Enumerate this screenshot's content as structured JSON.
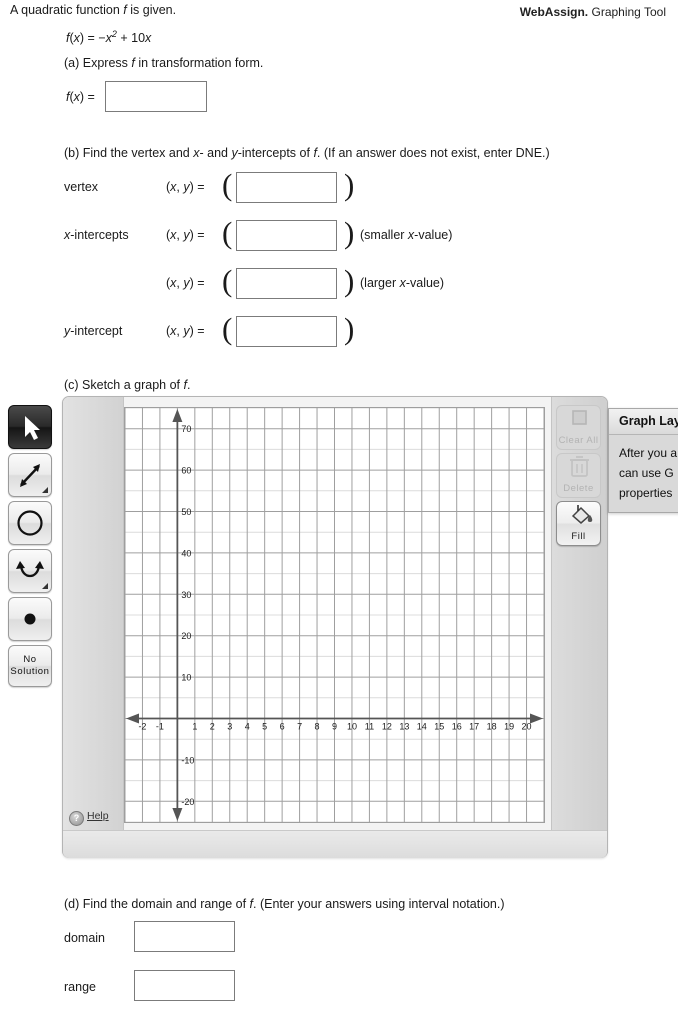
{
  "problem": {
    "intro_pre": "A quadratic function ",
    "intro_var": "f",
    "intro_post": " is given.",
    "equation": {
      "lhs_f": "f",
      "lhs_open": "(",
      "lhs_x": "x",
      "lhs_close": ")",
      "eq": " = −",
      "base": "x",
      "exponent": "2",
      "tail": " + 10",
      "tail_var": "x"
    }
  },
  "parts": {
    "a": {
      "label_pre": "(a) Express ",
      "label_var": "f",
      "label_post": " in transformation form.",
      "field_label_f": "f",
      "field_label_open": "(",
      "field_label_x": "x",
      "field_label_close": ") =",
      "input_value": "",
      "input_placeholder": ""
    },
    "b": {
      "label_pre": "(b) Find the vertex and ",
      "label_x": "x",
      "label_mid": "- and ",
      "label_y": "y",
      "label_post": "-intercepts of ",
      "label_f": "f",
      "label_end": ". (If an answer does not exist, enter DNE.)",
      "xy_label_open": "(",
      "xy_label_x": "x",
      "xy_label_comma": ", ",
      "xy_label_y": "y",
      "xy_label_close": ") =",
      "paren_open": "(",
      "paren_close": ")",
      "rows": [
        {
          "name_prefix": "",
          "name_italic": "",
          "name_suffix": "vertex",
          "value": "",
          "note": ""
        },
        {
          "name_prefix": "",
          "name_italic": "x",
          "name_suffix": "-intercepts",
          "value": "",
          "note_pre": "(smaller ",
          "note_var": "x",
          "note_post": "-value)"
        },
        {
          "name_prefix": "",
          "name_italic": "",
          "name_suffix": "",
          "value": "",
          "note_pre": "(larger ",
          "note_var": "x",
          "note_post": "-value)"
        },
        {
          "name_prefix": "",
          "name_italic": "y",
          "name_suffix": "-intercept",
          "value": "",
          "note": ""
        }
      ]
    },
    "c": {
      "label_pre": "(c) Sketch a graph of ",
      "label_var": "f",
      "label_post": "."
    },
    "d": {
      "label_pre": "(d) Find the domain and range of ",
      "label_var": "f",
      "label_post": ". (Enter your answers using interval notation.)",
      "domain_label": "domain",
      "domain_value": "",
      "range_label": "range",
      "range_value": ""
    }
  },
  "graph_tool": {
    "left_tools": [
      {
        "name": "pointer-tool",
        "icon": "cursor-arrow-icon",
        "label": "",
        "state": "selected"
      },
      {
        "name": "line-tool",
        "icon": "double-arrow-line-icon",
        "label": "",
        "state": "normal"
      },
      {
        "name": "circle-tool",
        "icon": "circle-icon",
        "label": "",
        "state": "normal"
      },
      {
        "name": "parabola-tool",
        "icon": "parabola-icon",
        "label": "",
        "state": "normal"
      },
      {
        "name": "point-tool",
        "icon": "filled-dot-icon",
        "label": "",
        "state": "normal"
      },
      {
        "name": "no-solution-tool",
        "icon": "",
        "label": "No\nSolution",
        "state": "normal"
      }
    ],
    "no_solution_line1": "No",
    "no_solution_line2": "Solution",
    "right_tools": [
      {
        "name": "clear-all-button",
        "icon": "square-outline-icon",
        "label": "Clear All",
        "state": "disabled"
      },
      {
        "name": "delete-button",
        "icon": "trash-can-icon",
        "label": "Delete",
        "state": "disabled"
      },
      {
        "name": "fill-button",
        "icon": "paint-bucket-icon",
        "label": "Fill",
        "state": "enabled"
      }
    ],
    "help_label": "Help",
    "help_icon_glyph": "?",
    "footer_brand": "WebAssign.",
    "footer_text": " Graphing Tool",
    "layers_panel": {
      "title": "Graph Lay",
      "line1": "After you a",
      "line2": "can use G",
      "line3": "properties"
    }
  },
  "chart_data": {
    "type": "line",
    "title": "",
    "xlabel": "",
    "ylabel": "",
    "xlim": [
      -3,
      21
    ],
    "ylim": [
      -25,
      75
    ],
    "x_ticks": [
      -2,
      -1,
      1,
      2,
      3,
      4,
      5,
      6,
      7,
      8,
      9,
      10,
      11,
      12,
      13,
      14,
      15,
      16,
      17,
      18,
      19,
      20
    ],
    "y_ticks": [
      70,
      60,
      50,
      40,
      30,
      20,
      10,
      -10,
      -20
    ],
    "x_major_step": 1,
    "y_major_step": 10,
    "y_minor_step": 5,
    "grid": true,
    "axis_color": "#555555",
    "major_grid_color": "#9a9a9a",
    "minor_grid_color": "#d9d9d9",
    "series": [],
    "legend": []
  }
}
